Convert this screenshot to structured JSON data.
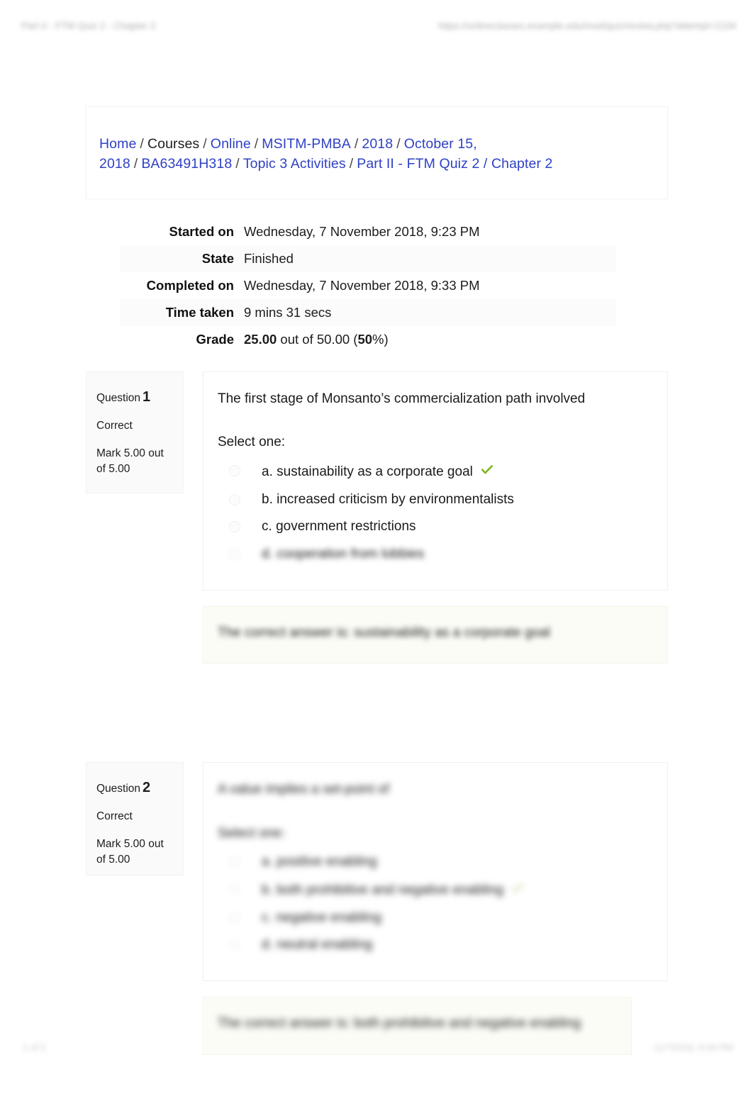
{
  "print_header": {
    "left": "Part II - FTM Quiz 2 - Chapter 2",
    "right": "https://onlineclasses.example.edu/mod/quiz/review.php?attempt=1234"
  },
  "print_footer": {
    "left": "1 of 2",
    "right": "11/7/2018, 9:34 PM"
  },
  "breadcrumb": {
    "items": [
      {
        "label": "Home",
        "link": true
      },
      {
        "label": "Courses",
        "link": false
      },
      {
        "label": "Online",
        "link": true
      },
      {
        "label": "MSITM-PMBA",
        "link": true
      },
      {
        "label": "2018",
        "link": true
      },
      {
        "label": "October 15, 2018",
        "link": true
      },
      {
        "label": "BA63491H318",
        "link": true
      },
      {
        "label": "Topic 3 Activities",
        "link": true
      },
      {
        "label": "Part II - FTM Quiz 2 / Chapter 2",
        "link": true
      }
    ],
    "separator": "/"
  },
  "summary": {
    "rows": [
      {
        "label": "Started on",
        "value": "Wednesday, 7 November 2018, 9:23 PM"
      },
      {
        "label": "State",
        "value": "Finished"
      },
      {
        "label": "Completed on",
        "value": "Wednesday, 7 November 2018, 9:33 PM"
      },
      {
        "label": "Time taken",
        "value": "9 mins 31 secs"
      }
    ],
    "grade": {
      "label": "Grade",
      "score": "25.00",
      "mid": " out of 50.00 (",
      "percent": "50",
      "tail": "%)"
    }
  },
  "questions": [
    {
      "label": "Question",
      "number": "1",
      "state": "Correct",
      "mark": "Mark 5.00 out of 5.00",
      "text": "The first stage of Monsanto’s commercialization path involved",
      "select_prompt": "Select one:",
      "options": [
        {
          "letter": "a.",
          "text": "sustainability as a corporate goal",
          "selected": true,
          "blurred": false
        },
        {
          "letter": "b.",
          "text": "increased criticism by environmentalists",
          "selected": false,
          "blurred": false
        },
        {
          "letter": "c.",
          "text": "government restrictions",
          "selected": false,
          "blurred": false
        },
        {
          "letter": "d.",
          "text": "cooperation from lobbies",
          "selected": false,
          "blurred": true
        }
      ],
      "feedback": "The correct answer is: sustainability as a corporate goal",
      "feedback_blurred": true
    },
    {
      "label": "Question",
      "number": "2",
      "state": "Correct",
      "mark": "Mark 5.00 out of 5.00",
      "text": "A value implies a set-point of",
      "select_prompt": "Select one:",
      "options": [
        {
          "letter": "a.",
          "text": "positive enabling",
          "selected": false,
          "blurred": true
        },
        {
          "letter": "b.",
          "text": "both prohibitive and negative enabling",
          "selected": true,
          "blurred": true
        },
        {
          "letter": "c.",
          "text": "negative enabling",
          "selected": false,
          "blurred": true
        },
        {
          "letter": "d.",
          "text": "neutral enabling",
          "selected": false,
          "blurred": true
        }
      ],
      "feedback": "The correct answer is: both prohibitive and negative enabling",
      "feedback_blurred": true
    }
  ],
  "icons": {
    "correct_tick": "check-mark-icon"
  },
  "colors": {
    "link": "#2f41c4",
    "correct_green": "#7cb518",
    "page_bg": "#ffffff",
    "info_panel_bg": "#fafafa",
    "feedback_bg": "#fcfcf7",
    "question_border": "#e9f2f6"
  }
}
